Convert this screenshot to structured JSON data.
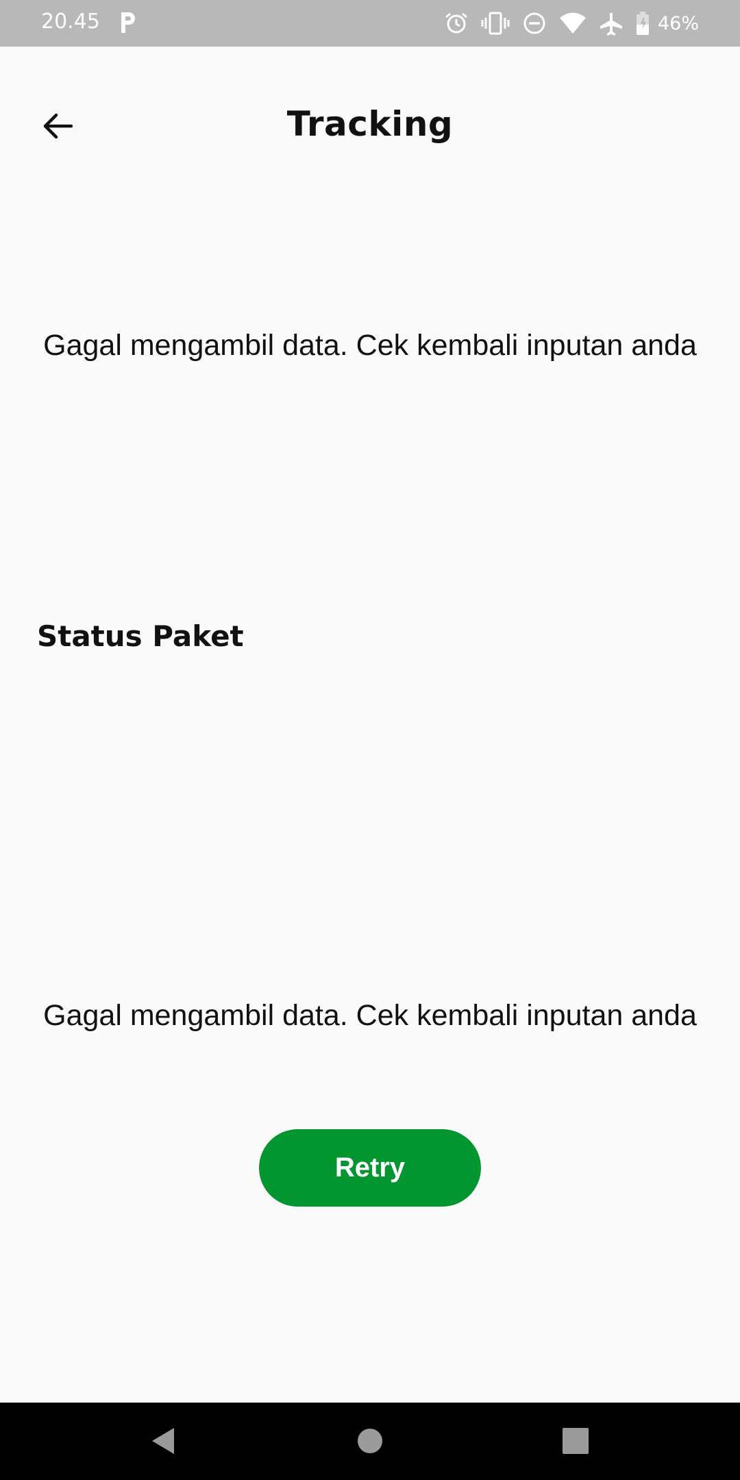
{
  "status_bar": {
    "time": "20.45",
    "battery": "46%",
    "icons": [
      "parking-icon",
      "alarm-icon",
      "vibrate-icon",
      "do-not-disturb-icon",
      "wifi-icon",
      "airplane-icon",
      "battery-icon"
    ]
  },
  "header": {
    "title": "Tracking",
    "back_icon": "arrow-left-icon"
  },
  "main": {
    "error_message_top": "Gagal mengambil data. Cek kembali inputan anda",
    "section_title": "Status Paket",
    "error_message_bottom": "Gagal mengambil data. Cek kembali inputan anda",
    "retry_label": "Retry"
  },
  "nav_bar": {
    "buttons": [
      "back-triangle-icon",
      "home-circle-icon",
      "recents-square-icon"
    ]
  },
  "colors": {
    "accent": "#039630",
    "status_bar": "#b8b8b8",
    "background": "#fafafa",
    "nav_bar": "#000000"
  }
}
